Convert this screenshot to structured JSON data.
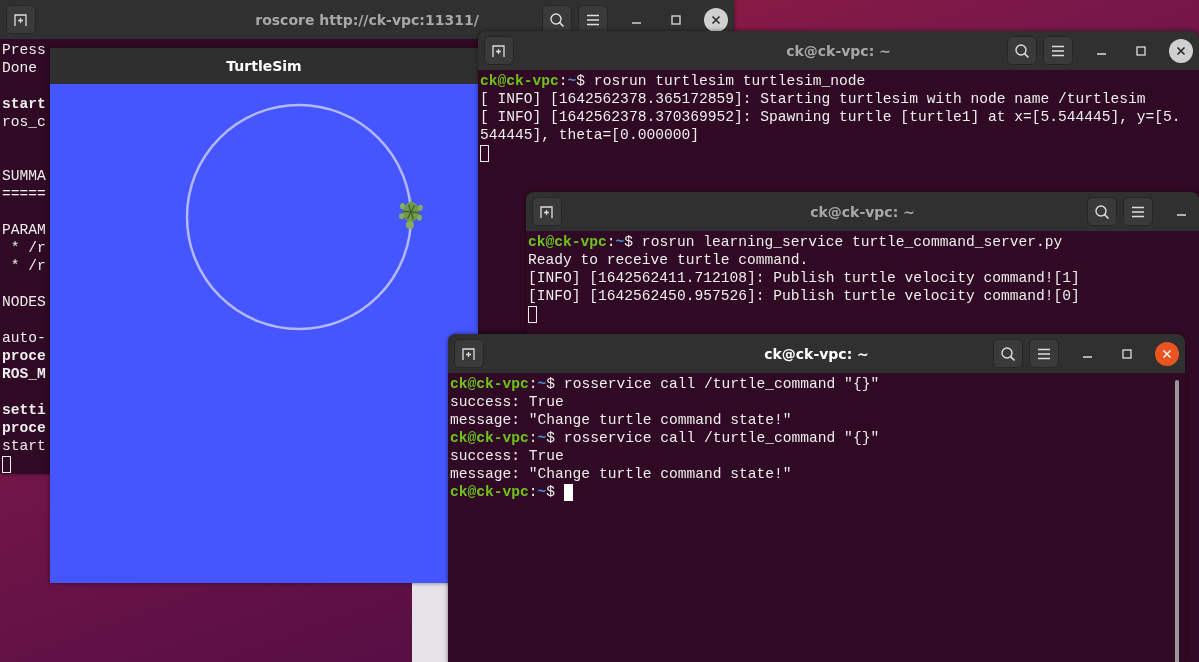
{
  "windows": [
    {
      "kind": "terminal",
      "title": "roscore http://ck-vpc:11311/",
      "focused": false,
      "controls": [
        {
          "kind": "new-tab"
        },
        {
          "kind": "search"
        },
        {
          "kind": "menu"
        },
        {
          "kind": "minimize"
        },
        {
          "kind": "maximize"
        },
        {
          "kind": "close"
        }
      ],
      "lines": [
        {
          "kind": "output",
          "text": "Press",
          "bold": false
        },
        {
          "kind": "output",
          "text": "Done",
          "bold": false
        },
        {
          "kind": "blank"
        },
        {
          "kind": "output",
          "text": "start",
          "bold": true
        },
        {
          "kind": "output",
          "text": "ros_c",
          "bold": false
        },
        {
          "kind": "blank"
        },
        {
          "kind": "blank"
        },
        {
          "kind": "output",
          "text": "SUMMA",
          "bold": false
        },
        {
          "kind": "output",
          "text": "=====",
          "bold": false
        },
        {
          "kind": "blank"
        },
        {
          "kind": "output",
          "text": "PARAM",
          "bold": false
        },
        {
          "kind": "output",
          "text": " * /r",
          "bold": false
        },
        {
          "kind": "output",
          "text": " * /r",
          "bold": false
        },
        {
          "kind": "blank"
        },
        {
          "kind": "output",
          "text": "NODES",
          "bold": false
        },
        {
          "kind": "blank"
        },
        {
          "kind": "output",
          "text": "auto-",
          "bold": false
        },
        {
          "kind": "output",
          "text": "proce",
          "bold": true
        },
        {
          "kind": "output",
          "text": "ROS_M",
          "bold": true
        },
        {
          "kind": "blank"
        },
        {
          "kind": "output",
          "text": "setti",
          "bold": true
        },
        {
          "kind": "output",
          "text": "proce",
          "bold": true
        },
        {
          "kind": "output",
          "text": "start",
          "bold": false
        },
        {
          "kind": "cursor"
        }
      ]
    },
    {
      "kind": "turtlesim",
      "title": "TurtleSim"
    },
    {
      "kind": "terminal",
      "title": "ck@ck-vpc: ~",
      "focused": false,
      "controls": [
        {
          "kind": "new-tab"
        },
        {
          "kind": "search"
        },
        {
          "kind": "menu"
        },
        {
          "kind": "minimize"
        },
        {
          "kind": "maximize"
        },
        {
          "kind": "close"
        }
      ],
      "lines": [
        {
          "kind": "prompt",
          "host": "ck@ck-vpc",
          "sep": ":",
          "path": "~",
          "command": "$ rosrun turtlesim turtlesim_node",
          "cursor": false
        },
        {
          "kind": "output",
          "text": "[ INFO] [1642562378.365172859]: Starting turtlesim with node name /turtlesim"
        },
        {
          "kind": "output",
          "text": "[ INFO] [1642562378.370369952]: Spawning turtle [turtle1] at x=[5.544445], y=[5."
        },
        {
          "kind": "output",
          "text": "544445], theta=[0.000000]"
        },
        {
          "kind": "cursor"
        }
      ]
    },
    {
      "kind": "terminal",
      "title": "ck@ck-vpc: ~",
      "focused": false,
      "controls": [
        {
          "kind": "new-tab"
        },
        {
          "kind": "search"
        },
        {
          "kind": "menu"
        },
        {
          "kind": "minimize"
        }
      ],
      "lines": [
        {
          "kind": "prompt",
          "host": "ck@ck-vpc",
          "sep": ":",
          "path": "~",
          "command": "$ rosrun learning_service turtle_command_server.py",
          "cursor": false
        },
        {
          "kind": "output",
          "text": "Ready to receive turtle command."
        },
        {
          "kind": "output",
          "text": "[INFO] [1642562411.712108]: Publish turtle velocity command![1]"
        },
        {
          "kind": "output",
          "text": "[INFO] [1642562450.957526]: Publish turtle velocity command![0]"
        },
        {
          "kind": "cursor"
        }
      ]
    },
    {
      "kind": "terminal",
      "title": "ck@ck-vpc: ~",
      "focused": true,
      "controls": [
        {
          "kind": "new-tab"
        },
        {
          "kind": "search"
        },
        {
          "kind": "menu"
        },
        {
          "kind": "minimize"
        },
        {
          "kind": "maximize"
        },
        {
          "kind": "close"
        }
      ],
      "lines": [
        {
          "kind": "prompt",
          "host": "ck@ck-vpc",
          "sep": ":",
          "path": "~",
          "command": "$ rosservice call /turtle_command \"{}\"",
          "cursor": false
        },
        {
          "kind": "output",
          "text": "success: True"
        },
        {
          "kind": "output",
          "text": "message: \"Change turtle command state!\""
        },
        {
          "kind": "prompt",
          "host": "ck@ck-vpc",
          "sep": ":",
          "path": "~",
          "command": "$ rosservice call /turtle_command \"{}\"",
          "cursor": false
        },
        {
          "kind": "output",
          "text": "success: True"
        },
        {
          "kind": "output",
          "text": "message: \"Change turtle command state!\""
        },
        {
          "kind": "prompt",
          "host": "ck@ck-vpc",
          "sep": ":",
          "path": "~",
          "command": "$ ",
          "cursor": true
        }
      ]
    }
  ]
}
